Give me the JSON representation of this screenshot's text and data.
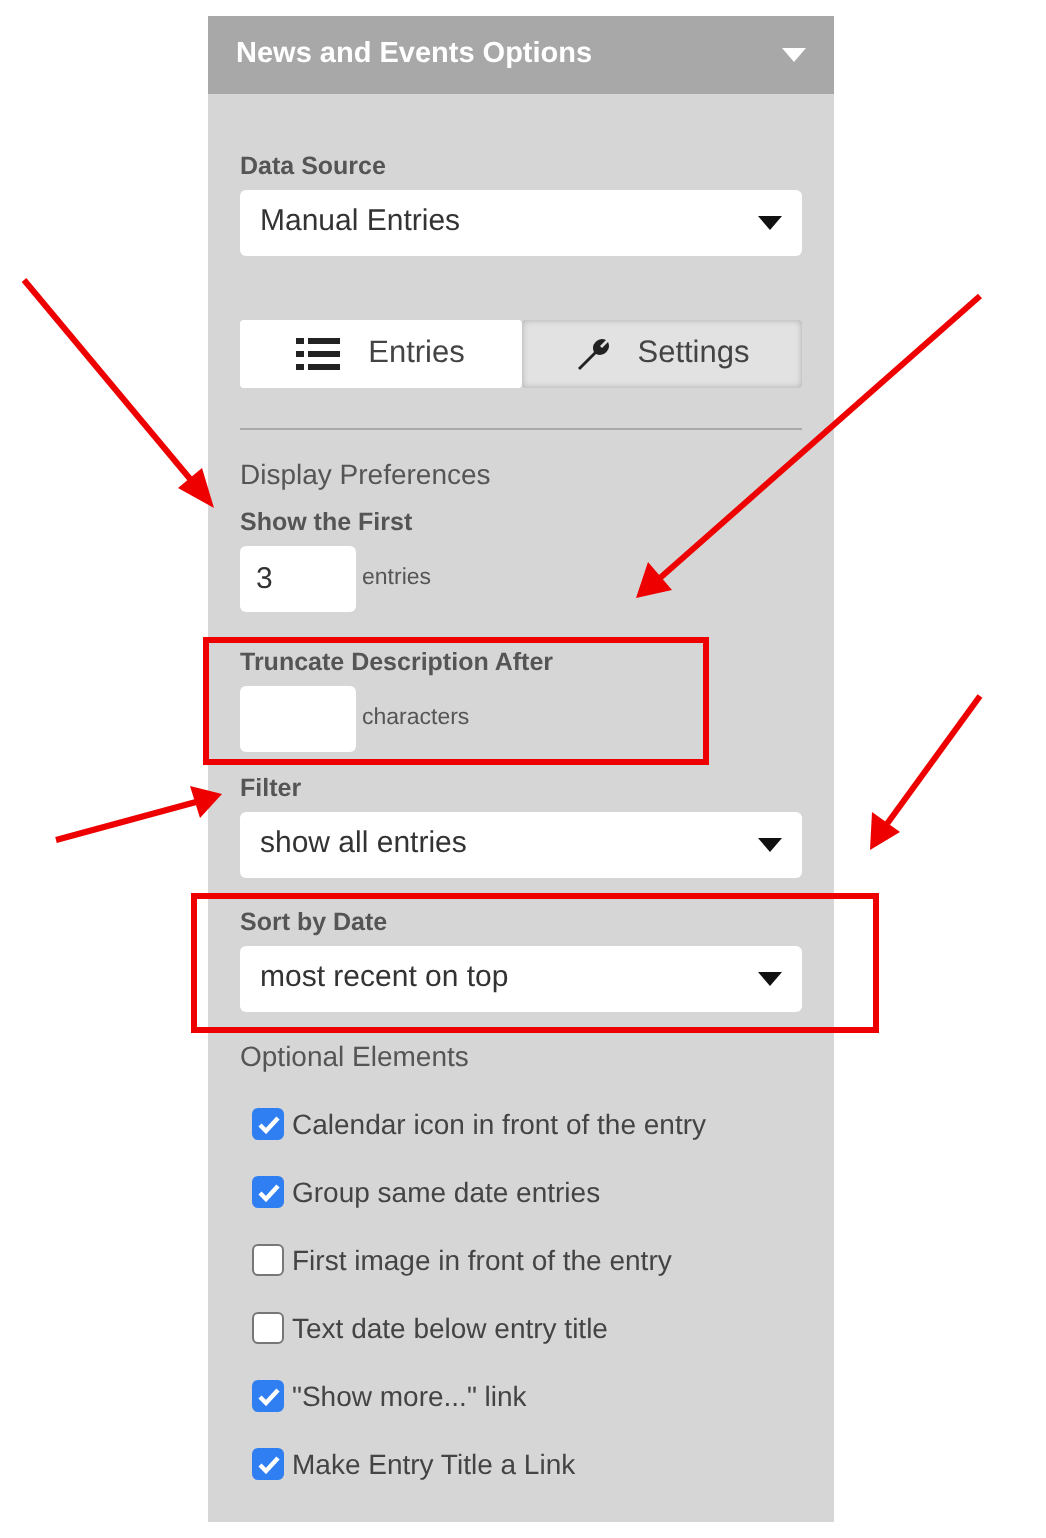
{
  "panel": {
    "title": "News and Events Options",
    "expanded": true
  },
  "data_source": {
    "label": "Data Source",
    "value": "Manual Entries"
  },
  "tabs": [
    {
      "label": "Entries",
      "selected": true
    },
    {
      "label": "Settings",
      "selected": false
    }
  ],
  "section_title": "Display Preferences",
  "show_first": {
    "label": "Show the First",
    "value": "3",
    "unit": "entries"
  },
  "truncate": {
    "label": "Truncate Description After",
    "unit": "characters"
  },
  "filter": {
    "label": "Filter",
    "value": "show all entries"
  },
  "sort": {
    "label": "Sort by Date",
    "value": "most recent on top"
  },
  "optional_title": "Optional Elements",
  "options": [
    {
      "label": "Calendar icon in front of the entry",
      "checked": true
    },
    {
      "label": "Group same date entries",
      "checked": true
    },
    {
      "label": "First image in front of the entry",
      "checked": false
    },
    {
      "label": "Text date below entry title",
      "checked": false
    },
    {
      "label": "\"Show more...\" link",
      "checked": true
    },
    {
      "label": "Make Entry Title a Link",
      "checked": true
    }
  ]
}
